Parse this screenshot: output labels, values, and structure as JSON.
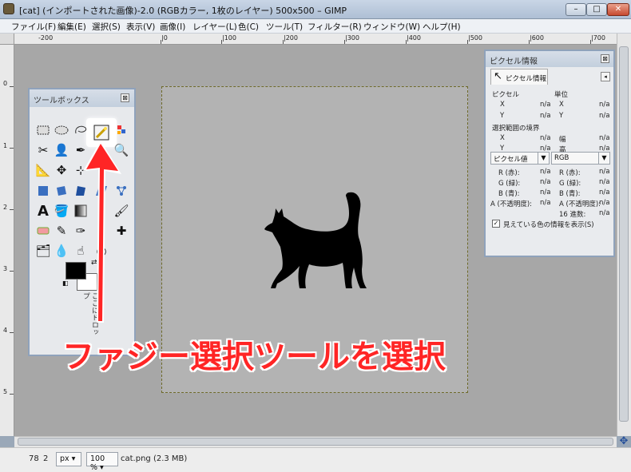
{
  "window": {
    "title": "[cat] (インポートされた画像)-2.0 (RGBカラー, 1枚のレイヤー) 500x500 – GIMP",
    "minimize": "–",
    "maximize": "□",
    "close": "✕"
  },
  "menu": [
    "ファイル(F)",
    "編集(E)",
    "選択(S)",
    "表示(V)",
    "画像(I)",
    "レイヤー(L)",
    "色(C)",
    "ツール(T)",
    "フィルター(R)",
    "ウィンドウ(W)",
    "ヘルプ(H)"
  ],
  "ruler": {
    "top_labels": [
      "-200",
      "|0",
      "|100",
      "|200",
      "|300",
      "|400",
      "|500",
      "|600",
      "|700"
    ],
    "left_labels": [
      "0",
      "1",
      "2",
      "3",
      "4",
      "5"
    ]
  },
  "toolbox": {
    "title": "ツールボックス",
    "close": "⊠",
    "drag_hint": "ここにドロップ"
  },
  "pixel_info": {
    "title": "ピクセル情報",
    "tab": "ピクセル情報",
    "pixel_label": "ピクセル",
    "unit_label": "単位",
    "x_label": "X",
    "y_label": "Y",
    "na": "n/a",
    "selection_bounds": "選択範囲の境界",
    "width_label": "幅",
    "height_label": "高",
    "mode_left": "ピクセル値",
    "mode_right": "RGB",
    "r_label": "R (赤):",
    "g_label": "G (緑):",
    "b_label": "B (青):",
    "a_label": "A (不透明度):",
    "hex_label": "16 進数:",
    "checkbox_label": "見えている色の情報を表示(S)"
  },
  "status": {
    "x": "78",
    "y": "2",
    "unit": "px",
    "zoom": "100 %",
    "file": "cat.png (2.3 MB)"
  },
  "annotation": {
    "caption": "ファジー選択ツールを選択",
    "color": "#ff2525"
  }
}
